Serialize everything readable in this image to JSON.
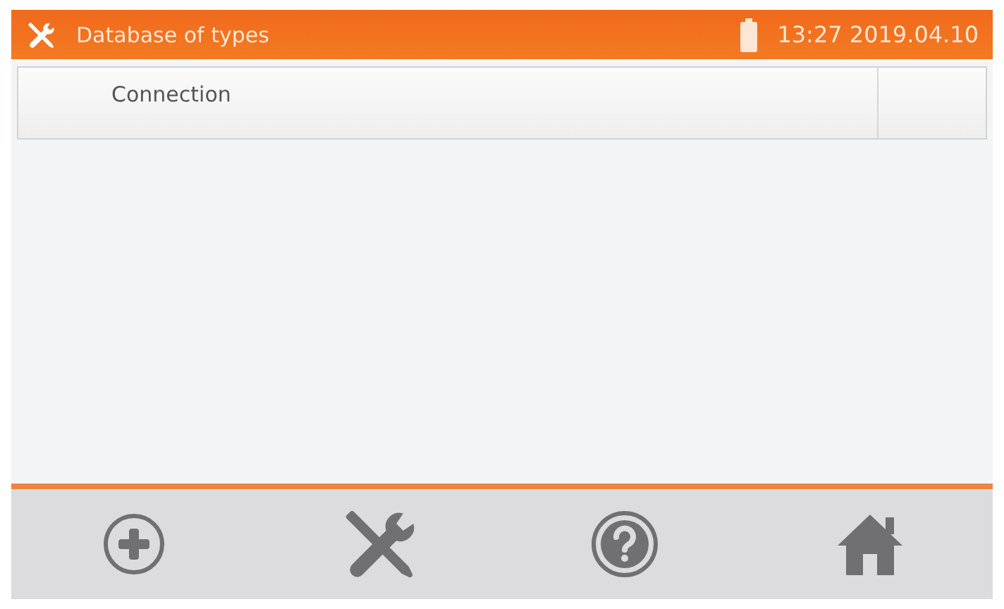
{
  "header": {
    "title": "Database of types",
    "time": "13:27",
    "date": "2019.04.10"
  },
  "rows": [
    {
      "label": "Connection"
    }
  ]
}
